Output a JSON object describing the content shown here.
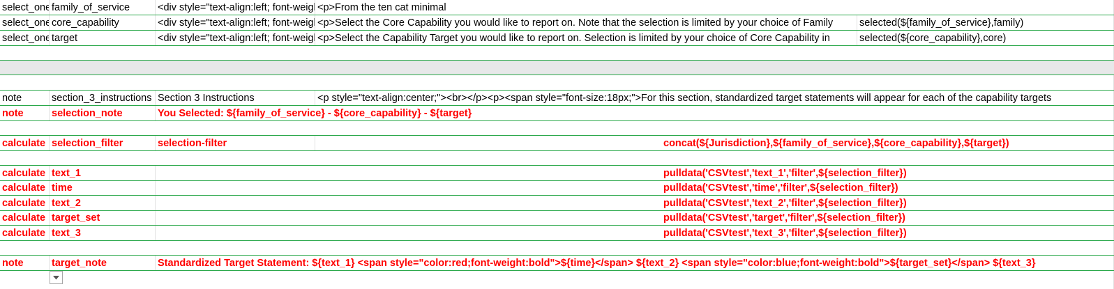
{
  "rows": [
    {
      "type": "select_one",
      "name": "family_of_service",
      "label": "<div style=\"text-align:left; font-weight",
      "hint": "<p>From the ten cat minimal"
    },
    {
      "type": "select_one",
      "name": "core_capability",
      "label": "<div style=\"text-align:left; font-weight",
      "hint": "<p>Select the Core Capability you would like to report on. Note that the selection is limited by your choice of  Family",
      "choice_filter": "selected(${family_of_service},family)"
    },
    {
      "type": "select_one",
      "name": "target",
      "label": "<div style=\"text-align:left; font-weight",
      "hint": "<p>Select the Capability Target you would like to report on. Selection is limited by your choice of Core Capability in",
      "choice_filter": "selected(${core_capability},core)"
    },
    {
      "type": "note",
      "name": "section_3_instructions",
      "label": "Section 3 Instructions",
      "hint": "<p style=\"text-align:center;\"><br></p><p><span style=\"font-size:18px;\">For this section, standardized target statements will appear for each of the capability targets"
    },
    {
      "type": "note",
      "name": "selection_note",
      "label": "You Selected: ${family_of_service} - ${core_capability} - ${target}"
    },
    {
      "type": "calculate",
      "name": "selection_filter",
      "label": "selection-filter",
      "calculation": "concat(${Jurisdiction},${family_of_service},${core_capability},${target})"
    },
    {
      "type": "calculate",
      "name": "text_1",
      "calculation": "pulldata('CSVtest','text_1','filter',${selection_filter})"
    },
    {
      "type": "calculate",
      "name": "time",
      "calculation": "pulldata('CSVtest','time','filter',${selection_filter})"
    },
    {
      "type": "calculate",
      "name": "text_2",
      "calculation": "pulldata('CSVtest','text_2','filter',${selection_filter})"
    },
    {
      "type": "calculate",
      "name": "target_set",
      "calculation": "pulldata('CSVtest','target','filter',${selection_filter})"
    },
    {
      "type": "calculate",
      "name": "text_3",
      "calculation": "pulldata('CSVtest','text_3','filter',${selection_filter})"
    },
    {
      "type": "note",
      "name": "target_note",
      "label": "Standardized Target Statement: ${text_1}  <span style=\"color:red;font-weight:bold\">${time}</span>  ${text_2}  <span style=\"color:blue;font-weight:bold\">${target_set}</span>  ${text_3}"
    }
  ],
  "icons": {
    "dropdown": "chevron-down-icon"
  },
  "colors": {
    "gridline": "#2aa84a",
    "highlight_text": "#ff0000",
    "grey_row": "#e7e8e9"
  }
}
